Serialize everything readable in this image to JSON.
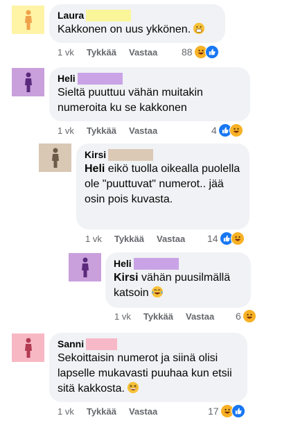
{
  "colors": {
    "bubble_bg": "#f0f2f5",
    "meta_gray": "#65676b",
    "like_blue": "#1877f2",
    "laugh_yellow": "#f7b125"
  },
  "comments": [
    {
      "name": "Laura",
      "text": "Kakkonen on uus ykkönen.",
      "trailing_emoji": "hushed-grin-emoji",
      "avatar_color": "#fff3a6",
      "figure_color": "#f0a24a",
      "surname_mask": "#fbf59a",
      "time": "1 vk",
      "like_label": "Tykkää",
      "reply_label": "Vastaa",
      "reaction_count": "88",
      "reactions": [
        "laugh",
        "like"
      ]
    },
    {
      "name": "Heli",
      "text": "Sieltä puuttuu vähän muitakin numeroita ku se kakkonen",
      "avatar_color": "#c9a0dc",
      "figure_color": "#5b2a7c",
      "surname_mask": "#c9a3e6",
      "time": "1 vk",
      "like_label": "Tykkää",
      "reply_label": "Vastaa",
      "reaction_count": "4",
      "reactions": [
        "like",
        "laugh"
      ]
    },
    {
      "name": "Kirsi",
      "mention": "Heli",
      "text": " eikö tuolla oikealla puolella ole \"puuttuvat\" numerot.. jää osin pois kuvasta.",
      "avatar_color": "#d8c8b4",
      "figure_color": "#6e5a48",
      "surname_mask": "#dbc9b5",
      "time": "1 vk",
      "like_label": "Tykkää",
      "reply_label": "Vastaa",
      "reaction_count": "14",
      "reactions": [
        "like",
        "laugh"
      ]
    },
    {
      "name": "Heli",
      "mention": "Kirsi",
      "text": " vähän puusilmällä katsoin",
      "trailing_emoji": "tears-of-joy-emoji",
      "avatar_color": "#c9a0dc",
      "figure_color": "#5b2a7c",
      "surname_mask": "#c9a3e6",
      "time": "1 vk",
      "like_label": "Tykkää",
      "reply_label": "Vastaa",
      "reaction_count": "6",
      "reactions": [
        "laugh"
      ]
    },
    {
      "name": "Sanni",
      "text": "Sekoittaisin numerot ja siinä olisi lapselle mukavasti puuhaa kun etsii sitä kakkosta.",
      "trailing_emoji": "grinning-squint-emoji",
      "avatar_color": "#f7b8c4",
      "figure_color": "#b23a52",
      "surname_mask": "#f7b8c8",
      "time": "1 vk",
      "like_label": "Tykkää",
      "reply_label": "Vastaa",
      "reaction_count": "17",
      "reactions": [
        "laugh",
        "like"
      ]
    }
  ]
}
